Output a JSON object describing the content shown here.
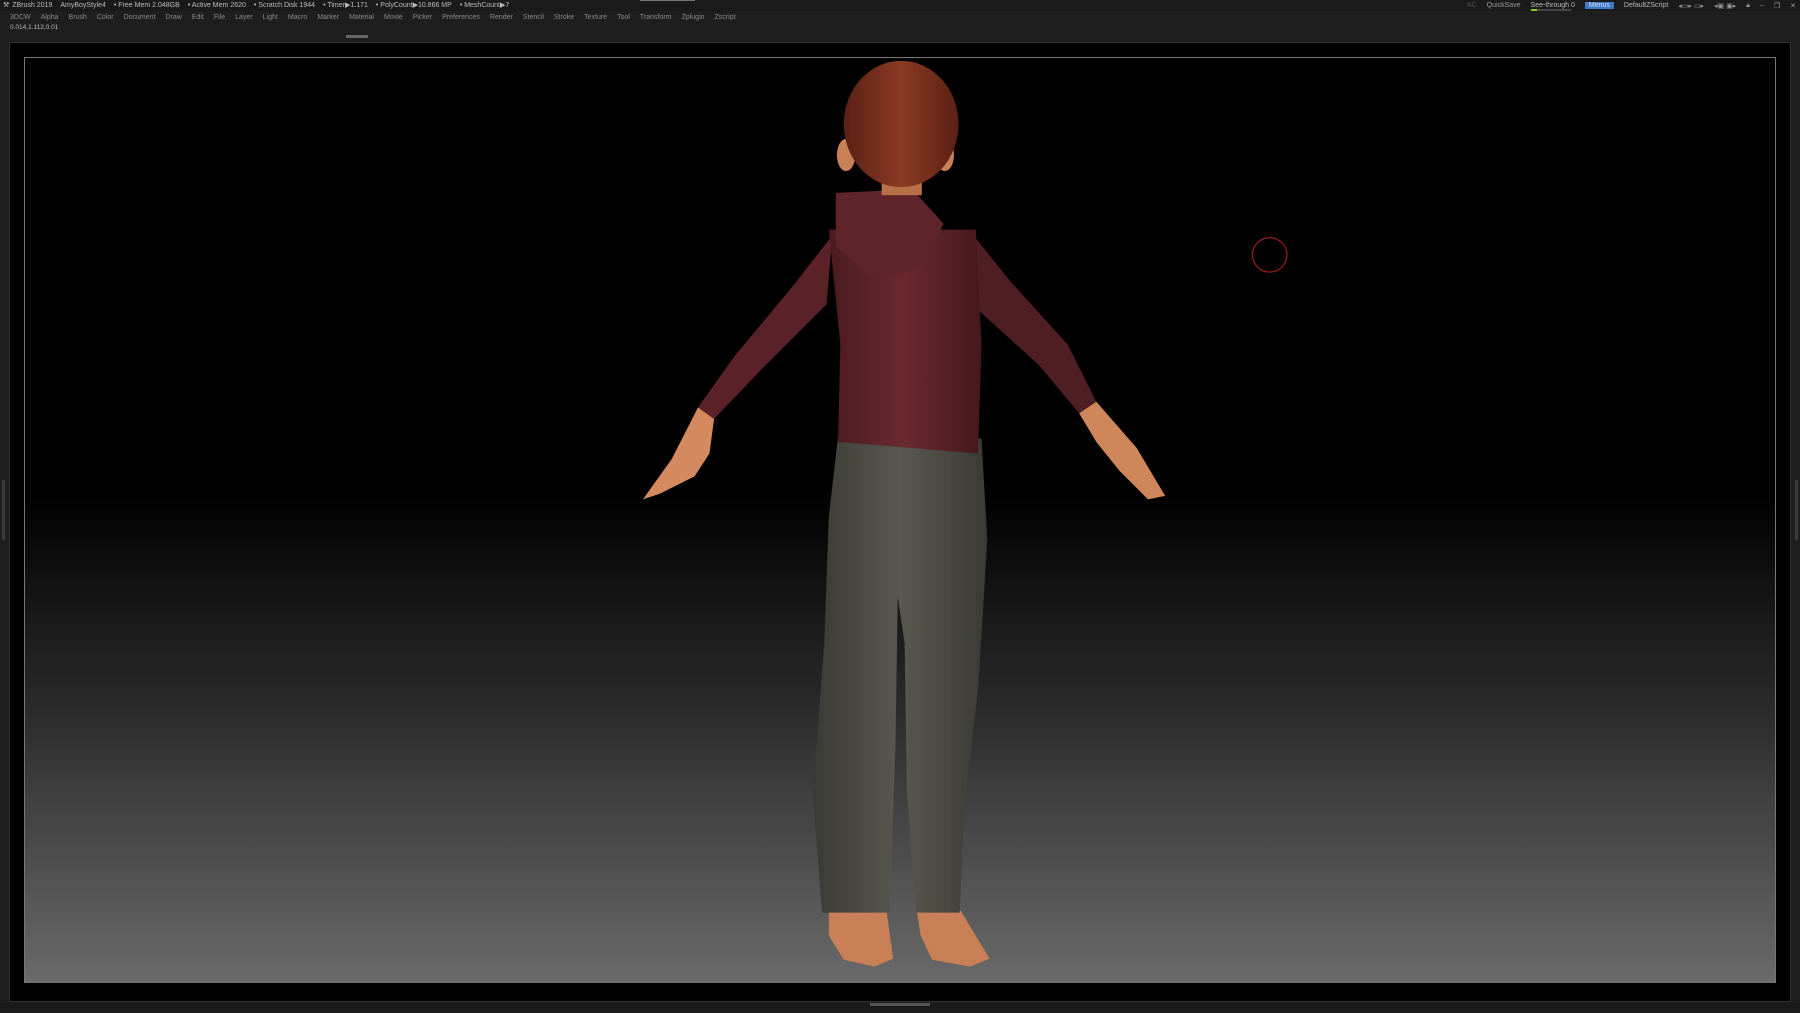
{
  "titlebar": {
    "app": "ZBrush 2019",
    "project": "AmyBoyStyle4",
    "free_mem": "• Free Mem 2.048GB",
    "active_mem": "• Active Mem 2620",
    "scratch": "• Scratch Disk 1944",
    "timer": "• Timer▶1.171",
    "polycount": "• PolyCount▶10.866 MP",
    "meshcount": "• MeshCount▶7"
  },
  "menu": [
    "3DCW",
    "Alpha",
    "Brush",
    "Color",
    "Document",
    "Draw",
    "Edit",
    "File",
    "Layer",
    "Light",
    "Macro",
    "Marker",
    "Material",
    "Movie",
    "Picker",
    "Preferences",
    "Render",
    "Stencil",
    "Stroke",
    "Texture",
    "Tool",
    "Transform",
    "Zplugin",
    "Zscript"
  ],
  "coords": "0.014,1.112,0.01",
  "right": {
    "ac": "AC",
    "quicksave": "QuickSave",
    "seethrough": "See-through  0",
    "menus": "Menus",
    "script": "DefaultZScript"
  },
  "colors": {
    "hoodie": "#5a2226",
    "pants": "#4c4c44",
    "skin": "#d48a5e",
    "hair": "#7a3020",
    "cursor": "#8a1a1a"
  }
}
